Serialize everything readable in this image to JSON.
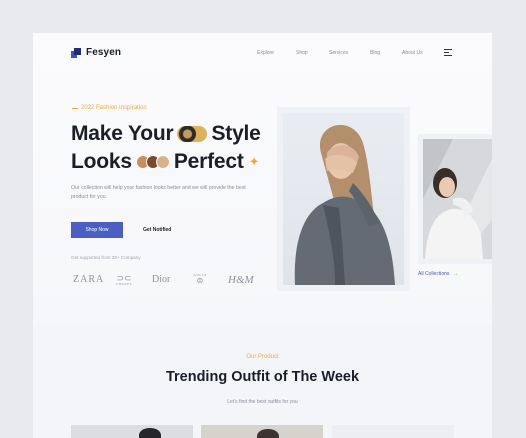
{
  "brand": {
    "name": "Fesyen"
  },
  "nav": {
    "items": [
      {
        "label": "Explore"
      },
      {
        "label": "Shop"
      },
      {
        "label": "Services"
      },
      {
        "label": "Blog"
      },
      {
        "label": "About Us"
      }
    ]
  },
  "hero": {
    "eyebrow": "2022 Fashion Inspiration",
    "headline_line1_a": "Make Your",
    "headline_line1_b": "Style",
    "headline_line2_a": "Looks",
    "headline_line2_b": "Perfect",
    "description": "Our collection will help your fashion looks better and we will provide the best product for you.",
    "shop_button": "Shop Now",
    "notified_button": "Get Notified",
    "brands_label": "Get supported from 28+ Company",
    "brands": [
      "ZARA",
      "CHANEL",
      "Dior",
      "GUCCI",
      "H&M"
    ]
  },
  "collections_link": "All Collections",
  "section2": {
    "eyebrow": "Our Product",
    "title": "Trending Outfit of The Week",
    "subtitle": "Let's find the best outfits for you"
  },
  "colors": {
    "accent_blue": "#4a5fc1",
    "accent_orange": "#f2a93b",
    "text_dark": "#1b1e28"
  }
}
